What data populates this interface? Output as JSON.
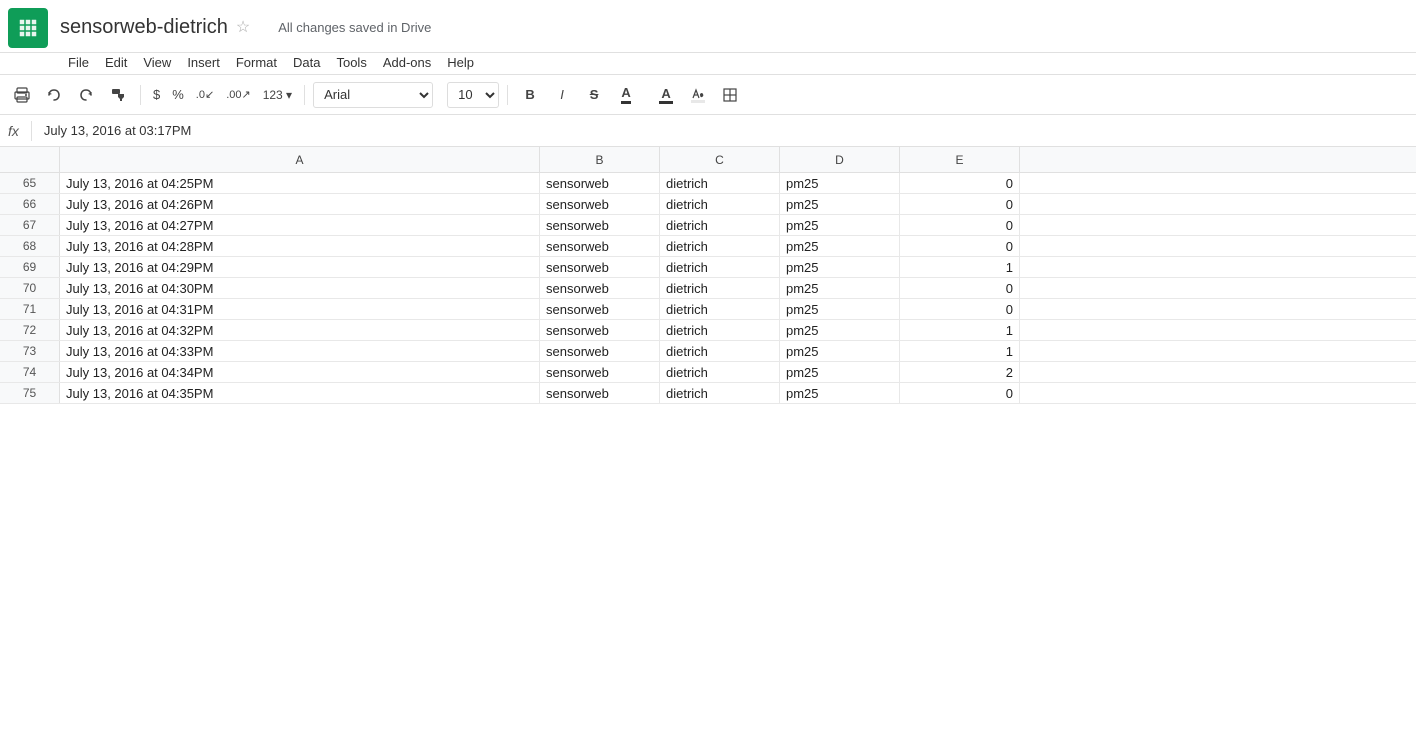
{
  "app": {
    "logo_label": "Google Sheets",
    "title": "sensorweb-dietrich",
    "star_icon": "☆",
    "save_status": "All changes saved in Drive"
  },
  "menu": {
    "items": [
      "File",
      "Edit",
      "View",
      "Insert",
      "Format",
      "Data",
      "Tools",
      "Add-ons",
      "Help"
    ]
  },
  "toolbar": {
    "print_icon": "🖨",
    "undo_icon": "↩",
    "redo_icon": "↪",
    "paint_icon": "🖌",
    "dollar_label": "$",
    "percent_label": "%",
    "decrease_decimal": ".0↙",
    "increase_decimal": ".00",
    "more_formats": "123",
    "font_name": "Arial",
    "font_size": "10",
    "bold_label": "B",
    "italic_label": "I",
    "strike_label": "S",
    "underline_label": "A",
    "fill_icon": "A",
    "border_icon": "⊞"
  },
  "formula_bar": {
    "fx_label": "fx",
    "content": "July 13, 2016 at 03:17PM"
  },
  "columns": {
    "headers": [
      "A",
      "B",
      "C",
      "D",
      "E"
    ]
  },
  "rows": [
    {
      "num": 65,
      "a": "July 13, 2016 at 04:25PM",
      "b": "sensorweb",
      "c": "dietrich",
      "d": "pm25",
      "e": "0"
    },
    {
      "num": 66,
      "a": "July 13, 2016 at 04:26PM",
      "b": "sensorweb",
      "c": "dietrich",
      "d": "pm25",
      "e": "0"
    },
    {
      "num": 67,
      "a": "July 13, 2016 at 04:27PM",
      "b": "sensorweb",
      "c": "dietrich",
      "d": "pm25",
      "e": "0"
    },
    {
      "num": 68,
      "a": "July 13, 2016 at 04:28PM",
      "b": "sensorweb",
      "c": "dietrich",
      "d": "pm25",
      "e": "0"
    },
    {
      "num": 69,
      "a": "July 13, 2016 at 04:29PM",
      "b": "sensorweb",
      "c": "dietrich",
      "d": "pm25",
      "e": "1"
    },
    {
      "num": 70,
      "a": "July 13, 2016 at 04:30PM",
      "b": "sensorweb",
      "c": "dietrich",
      "d": "pm25",
      "e": "0"
    },
    {
      "num": 71,
      "a": "July 13, 2016 at 04:31PM",
      "b": "sensorweb",
      "c": "dietrich",
      "d": "pm25",
      "e": "0"
    },
    {
      "num": 72,
      "a": "July 13, 2016 at 04:32PM",
      "b": "sensorweb",
      "c": "dietrich",
      "d": "pm25",
      "e": "1"
    },
    {
      "num": 73,
      "a": "July 13, 2016 at 04:33PM",
      "b": "sensorweb",
      "c": "dietrich",
      "d": "pm25",
      "e": "1"
    },
    {
      "num": 74,
      "a": "July 13, 2016 at 04:34PM",
      "b": "sensorweb",
      "c": "dietrich",
      "d": "pm25",
      "e": "2"
    },
    {
      "num": 75,
      "a": "July 13, 2016 at 04:35PM",
      "b": "sensorweb",
      "c": "dietrich",
      "d": "pm25",
      "e": "0"
    }
  ]
}
